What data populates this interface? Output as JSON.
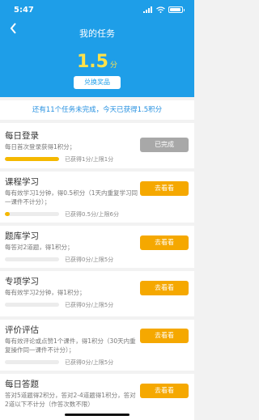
{
  "status": {
    "time": "5:47"
  },
  "header": {
    "title": "我的任务",
    "points": "1.5",
    "points_unit": "分",
    "redeem_label": "兑换奖品"
  },
  "notice": "还有11个任务未完成，今天已获得1.5积分",
  "colors": {
    "primary": "#1e9ee8",
    "accent": "#f5a800",
    "points": "#ffe24a",
    "done": "#a8a8a8"
  },
  "tasks": [
    {
      "title": "每日登录",
      "desc": "每日首次登录获得1积分；",
      "progress_text": "已获得1分/上限1分",
      "progress": 1.0,
      "button": "已完成",
      "done": true
    },
    {
      "title": "课程学习",
      "desc": "每有效学习1分钟，得0.5积分（1天内重复学习同一课件不计分）；",
      "progress_text": "已获得0.5分/上限6分",
      "progress": 0.083,
      "button": "去看看",
      "done": false
    },
    {
      "title": "题库学习",
      "desc": "每答对2道题，得1积分；",
      "progress_text": "已获得0分/上限5分",
      "progress": 0,
      "button": "去看看",
      "done": false
    },
    {
      "title": "专项学习",
      "desc": "每有效学习2分钟，得1积分；",
      "progress_text": "已获得0分/上限5分",
      "progress": 0,
      "button": "去看看",
      "done": false
    },
    {
      "title": "评价评估",
      "desc": "每有效评论或点赞1个课件，得1积分（30天内重复操作同一课件不计分）；",
      "progress_text": "已获得0分/上限5分",
      "progress": 0,
      "button": "去看看",
      "done": false
    },
    {
      "title": "每日答题",
      "desc": "答对5道题得2积分，答对2-4道题得1积分，答对2道以下不计分（作答次数不限）",
      "progress_text": "",
      "progress": 0,
      "button": "去看看",
      "done": false
    }
  ]
}
